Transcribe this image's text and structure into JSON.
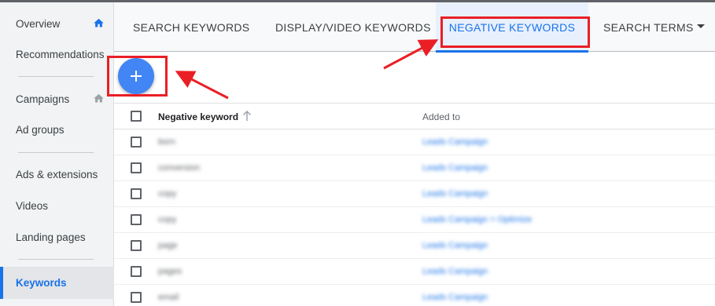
{
  "sidebar": {
    "items": [
      {
        "label": "Overview",
        "icon": "home-icon",
        "icon_color": "#1a73e8"
      },
      {
        "label": "Recommendations"
      },
      {
        "label": "Campaigns",
        "icon": "home-icon",
        "icon_color": "#9aa0a6"
      },
      {
        "label": "Ad groups"
      },
      {
        "label": "Ads & extensions"
      },
      {
        "label": "Videos"
      },
      {
        "label": "Landing pages"
      },
      {
        "label": "Keywords",
        "active": true
      }
    ]
  },
  "tabs": [
    {
      "label": "SEARCH KEYWORDS"
    },
    {
      "label": "DISPLAY/VIDEO KEYWORDS"
    },
    {
      "label": "NEGATIVE KEYWORDS",
      "active": true
    },
    {
      "label": "SEARCH TERMS",
      "has_dropdown": true
    }
  ],
  "fab": {
    "icon": "plus-icon",
    "color": "#4285f4"
  },
  "table": {
    "headers": {
      "keyword": "Negative keyword",
      "added_to": "Added to",
      "sort_icon": "arrow-up-icon"
    },
    "rows": [
      {
        "keyword": "born",
        "added_to": "Leads Campaign"
      },
      {
        "keyword": "conversion",
        "added_to": "Leads Campaign"
      },
      {
        "keyword": "copy",
        "added_to": "Leads Campaign"
      },
      {
        "keyword": "copy",
        "added_to": "Leads Campaign > Optimize"
      },
      {
        "keyword": "page",
        "added_to": "Leads Campaign"
      },
      {
        "keyword": "pages",
        "added_to": "Leads Campaign"
      },
      {
        "keyword": "email",
        "added_to": "Leads Campaign"
      }
    ]
  },
  "colors": {
    "accent": "#1a73e8",
    "annotation": "#ea1f25"
  }
}
